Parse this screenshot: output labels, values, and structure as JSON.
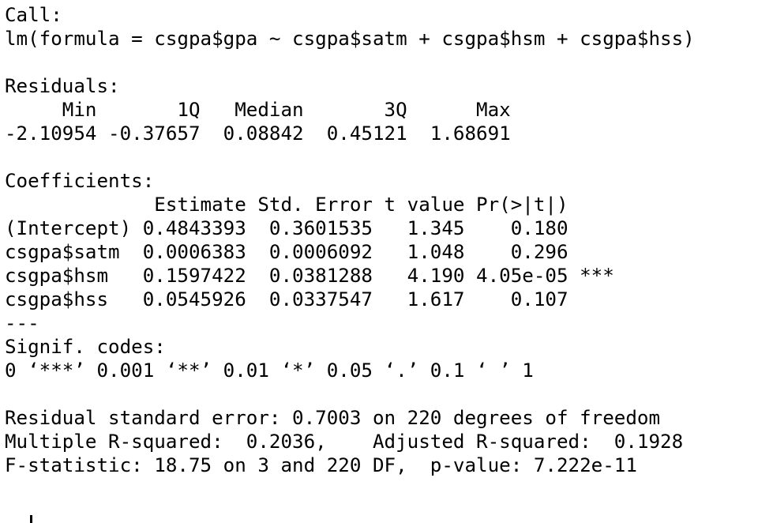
{
  "call": {
    "label": "Call:",
    "formula": "lm(formula = csgpa$gpa ~ csgpa$satm + csgpa$hsm + csgpa$hss)"
  },
  "residuals": {
    "label": "Residuals:",
    "header": "     Min       1Q   Median       3Q      Max ",
    "values": "-2.10954 -0.37657  0.08842  0.45121  1.68691 "
  },
  "coefficients": {
    "label": "Coefficients:",
    "header": "             Estimate Std. Error t value Pr(>|t|)    ",
    "rows": [
      "(Intercept) 0.4843393  0.3601535   1.345    0.180    ",
      "csgpa$satm  0.0006383  0.0006092   1.048    0.296    ",
      "csgpa$hsm   0.1597422  0.0381288   4.190 4.05e-05 ***",
      "csgpa$hss   0.0545926  0.0337547   1.617    0.107    "
    ],
    "separator": "---"
  },
  "signif": {
    "label": "Signif. codes:",
    "codes": "0 ‘***’ 0.001 ‘**’ 0.01 ‘*’ 0.05 ‘.’ 0.1 ‘ ’ 1"
  },
  "summary": {
    "residual_se": "Residual standard error: 0.7003 on 220 degrees of freedom",
    "r_squared": "Multiple R-squared:  0.2036,\tAdjusted R-squared:  0.1928 ",
    "f_statistic": "F-statistic: 18.75 on 3 and 220 DF,  p-value: 7.222e-11"
  }
}
